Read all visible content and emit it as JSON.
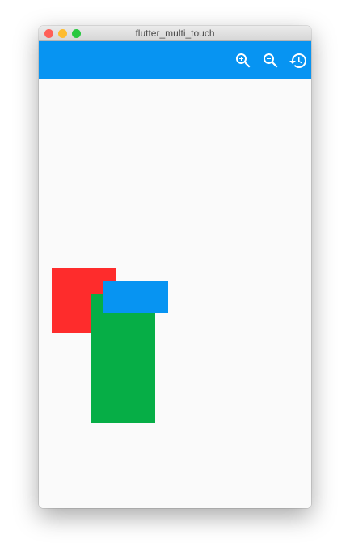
{
  "window": {
    "title": "flutter_multi_touch",
    "traffic_colors": {
      "close": "#fe5f57",
      "minimize": "#febc2e",
      "maximize": "#28c840"
    }
  },
  "app_bar": {
    "background": "#0794f2",
    "icon_color": "#ffffff",
    "actions": [
      {
        "name": "zoom-in-button",
        "icon": "zoom-in-icon"
      },
      {
        "name": "zoom-out-button",
        "icon": "zoom-out-icon"
      },
      {
        "name": "reset-button",
        "icon": "history-icon"
      }
    ]
  },
  "canvas": {
    "background": "#fafafa",
    "shapes": [
      {
        "name": "red-square",
        "color": "#fe2c2c"
      },
      {
        "name": "green-rectangle",
        "color": "#06ae46"
      },
      {
        "name": "blue-rectangle",
        "color": "#0794f2"
      }
    ]
  }
}
